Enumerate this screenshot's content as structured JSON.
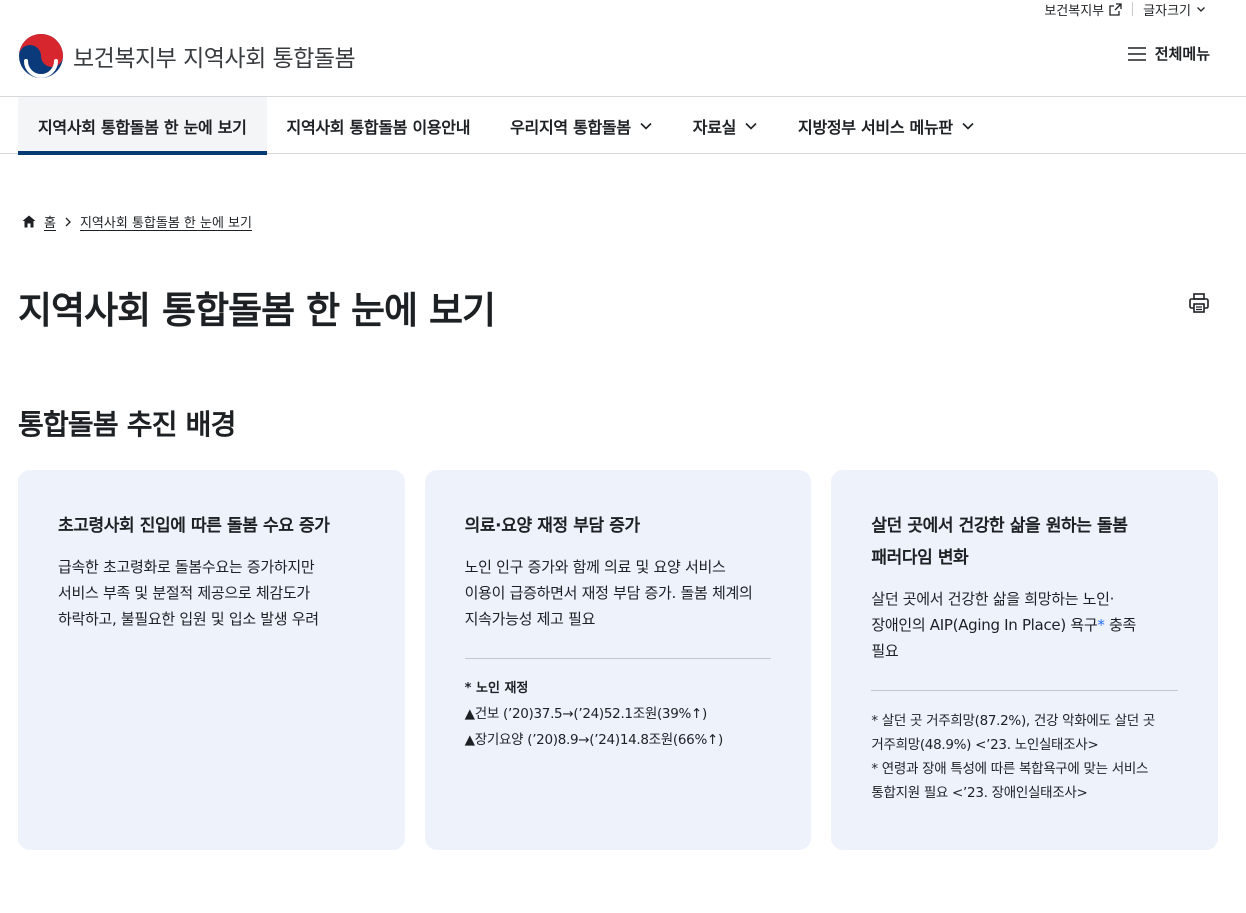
{
  "utility": {
    "ministry_link": "보건복지부",
    "font_size": "글자크기"
  },
  "header": {
    "logo_text": "보건복지부 지역사회 통합돌봄",
    "all_menu": "전체메뉴"
  },
  "gnb": {
    "items": [
      {
        "label": "지역사회 통합돌봄 한 눈에 보기",
        "active": true
      },
      {
        "label": "지역사회 통합돌봄 이용안내"
      },
      {
        "label": "우리지역 통합돌봄",
        "dropdown": true
      },
      {
        "label": "자료실",
        "dropdown": true
      },
      {
        "label": "지방정부 서비스 메뉴판",
        "dropdown": true
      }
    ]
  },
  "breadcrumb": {
    "home": "홈",
    "current": "지역사회 통합돌봄 한 눈에 보기"
  },
  "page": {
    "title": "지역사회 통합돌봄 한 눈에 보기",
    "section_title": "통합돌봄 추진 배경"
  },
  "cards": [
    {
      "title": "초고령사회 진입에 따른 돌봄 수요 증가",
      "desc": [
        "급속한 초고령화로 돌봄수요는 증가하지만",
        "서비스 부족 및 분절적 제공으로 체감도가",
        "하락하고, 불필요한 입원 및 입소 발생 우려"
      ]
    },
    {
      "title": "의료·요양 재정 부담 증가",
      "desc": [
        "노인 인구 증가와 함께 의료 및 요양 서비스",
        "이용이 급증하면서 재정 부담 증가. 돌봄 체계의",
        "지속가능성 제고 필요"
      ],
      "note_title": "* 노인 재정",
      "notes": [
        "▲건보 (’20)37.5→(’24)52.1조원(39%↑)",
        "▲장기요양 (’20)8.9→(’24)14.8조원(66%↑)"
      ]
    },
    {
      "title_lines": [
        "살던 곳에서 건강한 삶을 원하는 돌봄",
        "패러다임 변화"
      ],
      "desc_lines": [
        "살던 곳에서 건강한 삶을 희망하는 노인·",
        "장애인의 AIP(Aging In Place) 욕구",
        "*",
        " 충족",
        "필요"
      ],
      "notes": [
        "* 살던 곳 거주희망(87.2%), 건강 악화에도 살던 곳",
        "거주희망(48.9%) <’23. 노인실태조사>",
        "* 연령과 장애 특성에 따른 복합욕구에 맞는 서비스",
        "통합지원 필요 <’23. 장애인실태조사>"
      ]
    }
  ],
  "colors": {
    "primary": "#063a74",
    "card_bg": "#eef2fb",
    "accent_blue": "#256ef4"
  }
}
